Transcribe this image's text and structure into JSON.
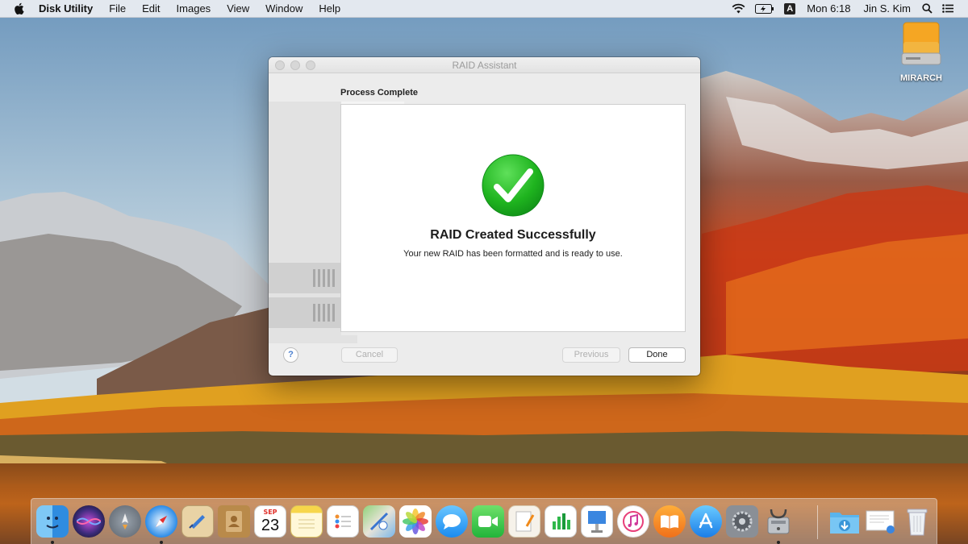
{
  "menubar": {
    "app_name": "Disk Utility",
    "menus": [
      "File",
      "Edit",
      "Images",
      "View",
      "Window",
      "Help"
    ],
    "input_source": "A",
    "clock": "Mon 6:18",
    "user": "Jin S. Kim"
  },
  "desktop": {
    "drive_label": "MIRARCH"
  },
  "window": {
    "title": "RAID Assistant",
    "section_label": "Process Complete",
    "result_title": "RAID Created Successfully",
    "result_message": "Your new RAID has been formatted and is ready to use.",
    "help_label": "?",
    "cancel_label": "Cancel",
    "previous_label": "Previous",
    "done_label": "Done"
  },
  "dock": {
    "apps": [
      {
        "name": "Finder",
        "icon": "finder-icon",
        "running": true
      },
      {
        "name": "Siri",
        "icon": "siri-icon",
        "running": false
      },
      {
        "name": "Launchpad",
        "icon": "launchpad-icon",
        "running": false
      },
      {
        "name": "Safari",
        "icon": "safari-icon",
        "running": true
      },
      {
        "name": "Mail",
        "icon": "mail-icon",
        "running": false
      },
      {
        "name": "Contacts",
        "icon": "contacts-icon",
        "running": false
      },
      {
        "name": "Calendar",
        "icon": "calendar-icon",
        "running": false,
        "month": "SEP",
        "day": "23"
      },
      {
        "name": "Notes",
        "icon": "notes-icon",
        "running": false
      },
      {
        "name": "Reminders",
        "icon": "reminders-icon",
        "running": false
      },
      {
        "name": "Maps",
        "icon": "maps-icon",
        "running": false
      },
      {
        "name": "Photos",
        "icon": "photos-icon",
        "running": false
      },
      {
        "name": "Messages",
        "icon": "messages-icon",
        "running": false
      },
      {
        "name": "FaceTime",
        "icon": "facetime-icon",
        "running": false
      },
      {
        "name": "Pages",
        "icon": "pages-icon",
        "running": false
      },
      {
        "name": "Numbers",
        "icon": "numbers-icon",
        "running": false
      },
      {
        "name": "Keynote",
        "icon": "keynote-icon",
        "running": false
      },
      {
        "name": "iTunes",
        "icon": "itunes-icon",
        "running": false
      },
      {
        "name": "iBooks",
        "icon": "ibooks-icon",
        "running": false
      },
      {
        "name": "App Store",
        "icon": "app-store-icon",
        "running": false
      },
      {
        "name": "System Preferences",
        "icon": "system-preferences-icon",
        "running": false
      },
      {
        "name": "Disk Utility",
        "icon": "disk-utility-icon",
        "running": true
      }
    ],
    "stacks": [
      {
        "name": "Downloads",
        "icon": "downloads-folder-icon"
      },
      {
        "name": "Preview",
        "icon": "preview-document-icon"
      },
      {
        "name": "Trash",
        "icon": "trash-icon"
      }
    ]
  },
  "colors": {
    "success_green": "#1fb41f",
    "accent_blue": "#2a7fe0",
    "window_bg": "#ececec"
  }
}
